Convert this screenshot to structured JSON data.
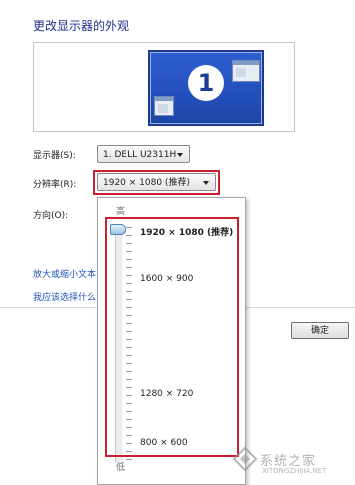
{
  "page": {
    "title": "更改显示器的外观"
  },
  "preview": {
    "monitor_number": "1"
  },
  "display": {
    "label": "显示器(S):",
    "value": "1. DELL U2311H"
  },
  "resolution": {
    "label": "分辨率(R):",
    "value": "1920 × 1080 (推荐)"
  },
  "orientation": {
    "label": "方向(O):"
  },
  "links": {
    "text_size": "放大或缩小文本",
    "which_settings": "我应该选择什么"
  },
  "buttons": {
    "ok": "确定"
  },
  "dropdown": {
    "high_label": "高",
    "low_label": "低",
    "options": [
      {
        "label": "1920 × 1080 (推荐)",
        "bold": true
      },
      {
        "label": "1600 × 900",
        "bold": false
      },
      {
        "label": "1280 × 720",
        "bold": false
      },
      {
        "label": "800 × 600",
        "bold": false
      }
    ],
    "selected_index": 0
  },
  "watermark": {
    "text": "系统之家",
    "url": "XITONGZHIJIA.NET"
  },
  "colors": {
    "accent": "#2550bd",
    "highlight": "#cc1f2d",
    "link": "#1f55b8"
  }
}
